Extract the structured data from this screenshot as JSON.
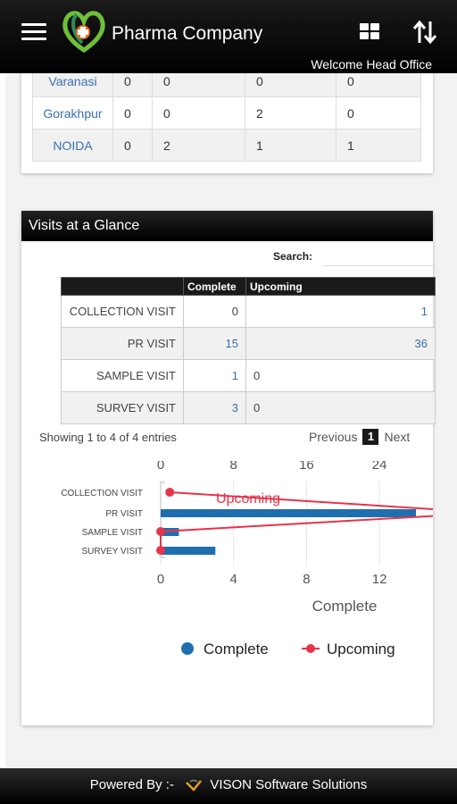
{
  "header": {
    "title": "Pharma Company",
    "welcome": "Welcome Head Office",
    "icons": [
      "menu-icon",
      "logo",
      "grid-icon",
      "sort-icon"
    ],
    "background": "#000000"
  },
  "city_table": {
    "rows": [
      {
        "city": "Varanasi",
        "v1": "0",
        "v2": "0",
        "v3": "0",
        "v4": "0"
      },
      {
        "city": "Gorakhpur",
        "v1": "0",
        "v2": "0",
        "v3": "2",
        "v4": "0"
      },
      {
        "city": "NOIDA",
        "v1": "0",
        "v2": "2",
        "v3": "1",
        "v4": "1"
      }
    ]
  },
  "visits": {
    "title": "Visits at a Glance",
    "search_label": "Search:",
    "search_value": "",
    "columns": [
      "",
      "Complete",
      "Upcoming"
    ],
    "rows": [
      {
        "name": "COLLECTION VISIT",
        "complete": "0",
        "upcoming": "1"
      },
      {
        "name": "PR VISIT",
        "complete": "15",
        "upcoming": "36"
      },
      {
        "name": "SAMPLE VISIT",
        "complete": "1",
        "upcoming": "0"
      },
      {
        "name": "SURVEY VISIT",
        "complete": "3",
        "upcoming": "0"
      }
    ],
    "showing": "Showing 1 to 4 of 4 entries",
    "pager": {
      "previous": "Previous",
      "page": "1",
      "next": "Next"
    }
  },
  "chart_data": {
    "type": "bar",
    "categories": [
      "COLLECTION VISIT",
      "PR VISIT",
      "SAMPLE VISIT",
      "SURVEY VISIT"
    ],
    "series": [
      {
        "name": "Complete",
        "type": "bar",
        "axis": "bottom",
        "values": [
          0,
          15,
          1,
          3
        ],
        "color": "#1f6fb0"
      },
      {
        "name": "Upcoming",
        "type": "line",
        "axis": "top",
        "values": [
          1,
          36,
          0,
          0
        ],
        "color": "#e8334a"
      }
    ],
    "top_axis": {
      "label": "Upcoming",
      "ticks": [
        "0",
        "8",
        "16",
        "24"
      ],
      "range": [
        0,
        28
      ]
    },
    "bottom_axis": {
      "label": "Complete",
      "ticks": [
        "0",
        "4",
        "8",
        "12"
      ],
      "range": [
        0,
        14
      ]
    },
    "annotation": "Upcoming",
    "legend": [
      "Complete",
      "Upcoming"
    ],
    "legend_position": "bottom"
  },
  "footer": {
    "prefix": "Powered By :-",
    "company": "VISON Software Solutions"
  }
}
